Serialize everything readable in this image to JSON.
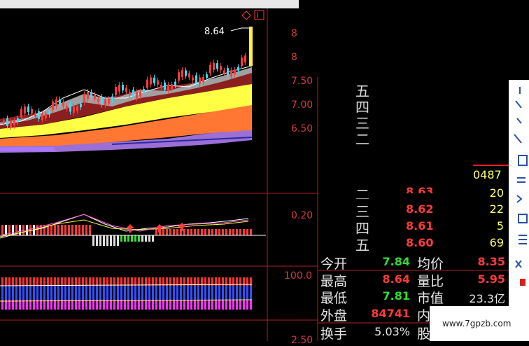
{
  "colors": {
    "up": "#ff3b3b",
    "down": "#33e0ff",
    "green": "#33dd33",
    "yellow": "#ffff55",
    "axis": "#b02020"
  },
  "main_chart": {
    "high_label": "8.64",
    "y_ticks": [
      "8",
      "8",
      "7.50",
      "7.00",
      "6.50"
    ]
  },
  "macd": {
    "ticks": [
      "0.20"
    ]
  },
  "indicator2": {
    "ticks": [
      "100.0",
      "2.50"
    ]
  },
  "top_right_icon": "diamond-icon",
  "order_book": {
    "sell_levels": [
      {
        "label": "五"
      },
      {
        "label": "四"
      },
      {
        "label": "三"
      },
      {
        "label": "二"
      }
    ],
    "volume_header": "0487",
    "partial_price": "8.63",
    "buy_levels": [
      {
        "label": "二",
        "price": "",
        "vol": "20"
      },
      {
        "label": "三",
        "price": "8.62",
        "vol": "22"
      },
      {
        "label": "四",
        "price": "8.61",
        "vol": "5"
      },
      {
        "label": "五",
        "price": "8.60",
        "vol": "69"
      }
    ]
  },
  "stats": {
    "open_label": "今开",
    "open_value": "7.84",
    "avg_label": "均价",
    "avg_value": "8.35",
    "high_label": "最高",
    "high_value": "8.64",
    "vol_ratio_label": "量比",
    "vol_ratio_value": "5.95",
    "low_label": "最低",
    "low_value": "7.81",
    "mcap_label": "市值",
    "mcap_value": "23.3亿",
    "outer_label": "外盘",
    "outer_value": "84741",
    "inner_label": "内",
    "turnover_label": "换手",
    "turnover_value": "5.03%",
    "share_label": "股"
  },
  "watermark": "www.7gpzb.com"
}
